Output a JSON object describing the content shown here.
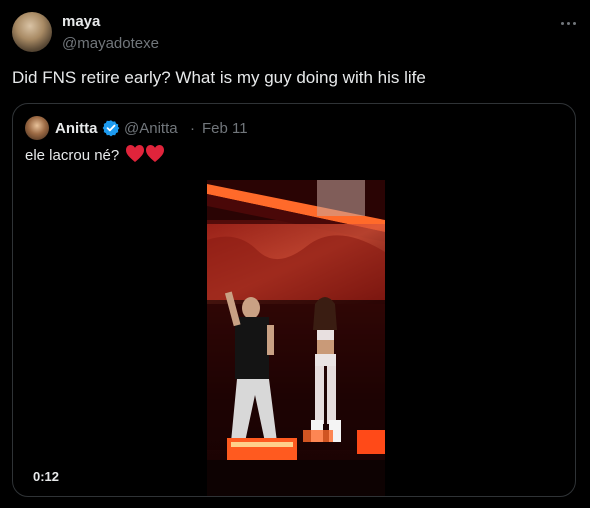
{
  "tweet": {
    "author_name": "maya",
    "author_handle": "@mayadotexe",
    "text": "Did FNS retire early? What is my guy doing with his life"
  },
  "quoted_tweet": {
    "author_name": "Anitta",
    "author_handle": "@Anitta",
    "separator": "·",
    "date": "Feb 11",
    "text": "ele lacrou né?",
    "emoji_hearts": 2,
    "video_duration": "0:12"
  },
  "colors": {
    "background": "#000000",
    "text_primary": "#e7e9ea",
    "text_secondary": "#71767b",
    "border": "#2f3336",
    "verified_blue": "#1d9bf0",
    "heart_red": "#e0243b"
  },
  "icons": {
    "more": "more-horizontal-icon",
    "verified": "verified-badge-icon",
    "heart": "red-heart-icon"
  }
}
